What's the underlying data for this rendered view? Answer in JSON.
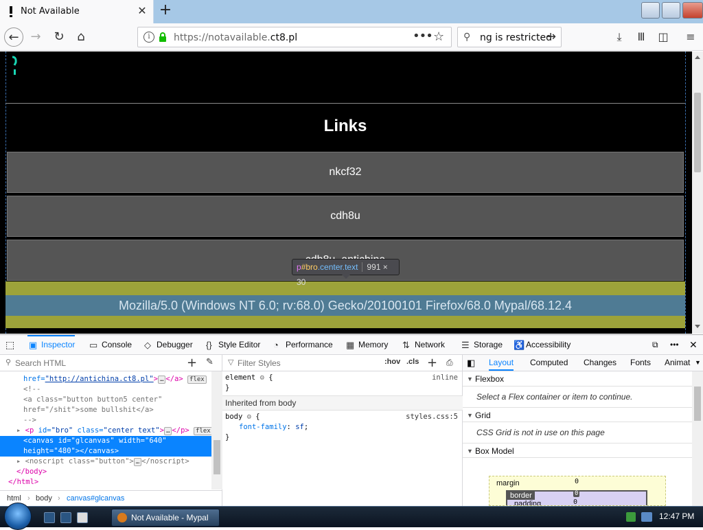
{
  "browser": {
    "tab_title": "Not Available",
    "url_prefix": "https://notavailable.",
    "url_domain": "ct8.pl",
    "search_text": "ng is restricted"
  },
  "page": {
    "heading": "Links",
    "links": [
      "nkcf32",
      "cdh8u",
      "cdh8u_antichina"
    ],
    "user_agent": "Mozilla/5.0 (Windows NT 6.0; rv:68.0) Gecko/20100101 Firefox/68.0 Mypal/68.12.4",
    "tooltip": {
      "tag": "p",
      "id": "#bro",
      "cls": ".center.text",
      "dims": "991 × 30"
    }
  },
  "devtools": {
    "tabs": [
      "Inspector",
      "Console",
      "Debugger",
      "Style Editor",
      "Performance",
      "Memory",
      "Network",
      "Storage",
      "Accessibility"
    ],
    "search_placeholder": "Search HTML",
    "filter_placeholder": "Filter Styles",
    "hov": ":hov",
    "cls": ".cls",
    "markup": {
      "l0_href_attr": "href=",
      "l0_href_val": "\"http://antichina.ct8.pl\"",
      "l0_tail": ">",
      "l0_close": "</a>",
      "badge_flex": "flex",
      "comment_open": "<!--",
      "l2a": "<a",
      "l2_class_attr": "class=",
      "l2_class_val": "\"button button5 center\"",
      "l3_href_attr": "href=",
      "l3_href_val": "\"/shit\"",
      "l3_text": ">some bullshit</a>",
      "comment_close": "-->",
      "p_open": "<p",
      "p_id_attr": "id=",
      "p_id_val": "\"bro\"",
      "p_class_attr": "class=",
      "p_class_val": "\"center text\"",
      "p_close": "</p>",
      "canvas_line1": "<canvas id=\"glcanvas\" width=\"640\"",
      "canvas_line2": "height=\"480\"></canvas>",
      "noscript_open": "<noscript",
      "noscript_class_attr": "class=",
      "noscript_class_val": "\"button\"",
      "noscript_close": "</noscript>",
      "body_close": "</body>",
      "html_close": "</html>"
    },
    "breadcrumbs": [
      "html",
      "body",
      "canvas#glcanvas"
    ],
    "rules": {
      "element_selector": "element",
      "element_src": "inline",
      "inherited_label": "Inherited from body",
      "body_selector": "body",
      "body_src": "styles.css:5",
      "prop": "font-family",
      "val": "sf"
    },
    "layout_tabs": [
      "Layout",
      "Computed",
      "Changes",
      "Fonts",
      "Animat"
    ],
    "sections": {
      "flexbox": "Flexbox",
      "flexbox_note": "Select a Flex container or item to continue.",
      "grid": "Grid",
      "grid_note": "CSS Grid is not in use on this page",
      "box_model": "Box Model"
    },
    "box_model": {
      "margin_label": "margin",
      "margin_val": "0",
      "border_label": "border",
      "border_val": "0",
      "padding_label": "padding",
      "padding_val": "0"
    }
  },
  "taskbar": {
    "task_label": "Not Available - Mypal",
    "clock": "12:47 PM"
  }
}
